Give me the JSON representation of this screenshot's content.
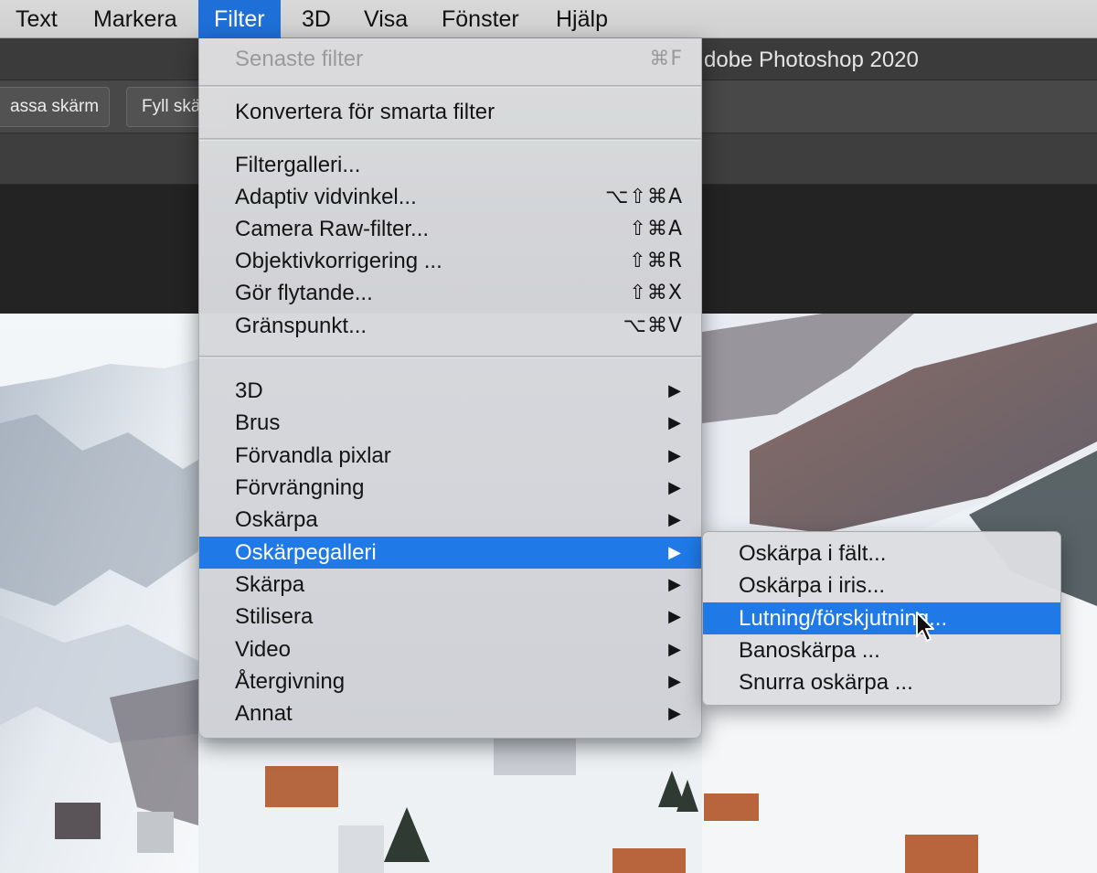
{
  "menubar": {
    "items": [
      {
        "label": "Text",
        "active": false
      },
      {
        "label": "Markera",
        "active": false
      },
      {
        "label": "Filter",
        "active": true
      },
      {
        "label": "3D",
        "active": false
      },
      {
        "label": "Visa",
        "active": false
      },
      {
        "label": "Fönster",
        "active": false
      },
      {
        "label": "Hjälp",
        "active": false
      }
    ]
  },
  "window": {
    "title": "dobe Photoshop 2020"
  },
  "options_bar": {
    "fit_screen_label": "assa skärm",
    "fill_screen_label": "Fyll skä"
  },
  "filter_menu": {
    "last_filter": {
      "label": "Senaste filter",
      "shortcut": "⌘F",
      "enabled": false
    },
    "convert_smart": {
      "label": "Konvertera för smarta filter"
    },
    "gallery_group": [
      {
        "label": "Filtergalleri...",
        "shortcut": ""
      },
      {
        "label": "Adaptiv vidvinkel...",
        "shortcut": "⌥⇧⌘A"
      },
      {
        "label": "Camera Raw-filter...",
        "shortcut": "⇧⌘A"
      },
      {
        "label": "Objektivkorrigering ...",
        "shortcut": "⇧⌘R"
      },
      {
        "label": "Gör flytande...",
        "shortcut": "⇧⌘X"
      },
      {
        "label": "Gränspunkt...",
        "shortcut": "⌥⌘V"
      }
    ],
    "submenu_group": [
      {
        "label": "3D",
        "highlighted": false
      },
      {
        "label": "Brus",
        "highlighted": false
      },
      {
        "label": "Förvandla pixlar",
        "highlighted": false
      },
      {
        "label": "Förvrängning",
        "highlighted": false
      },
      {
        "label": "Oskärpa",
        "highlighted": false
      },
      {
        "label": "Oskärpegalleri",
        "highlighted": true
      },
      {
        "label": "Skärpa",
        "highlighted": false
      },
      {
        "label": "Stilisera",
        "highlighted": false
      },
      {
        "label": "Video",
        "highlighted": false
      },
      {
        "label": "Återgivning",
        "highlighted": false
      },
      {
        "label": "Annat",
        "highlighted": false
      }
    ],
    "arrow_glyph": "▶"
  },
  "blur_gallery_submenu": {
    "items": [
      {
        "label": "Oskärpa i fält...",
        "highlighted": false
      },
      {
        "label": "Oskärpa i iris...",
        "highlighted": false
      },
      {
        "label": "Lutning/förskjutning...",
        "highlighted": true
      },
      {
        "label": "Banoskärpa ...",
        "highlighted": false
      },
      {
        "label": "Snurra oskärpa ...",
        "highlighted": false
      }
    ]
  },
  "colors": {
    "highlight": "#1f7ae8",
    "menubar_active": "#1f6fd8"
  }
}
